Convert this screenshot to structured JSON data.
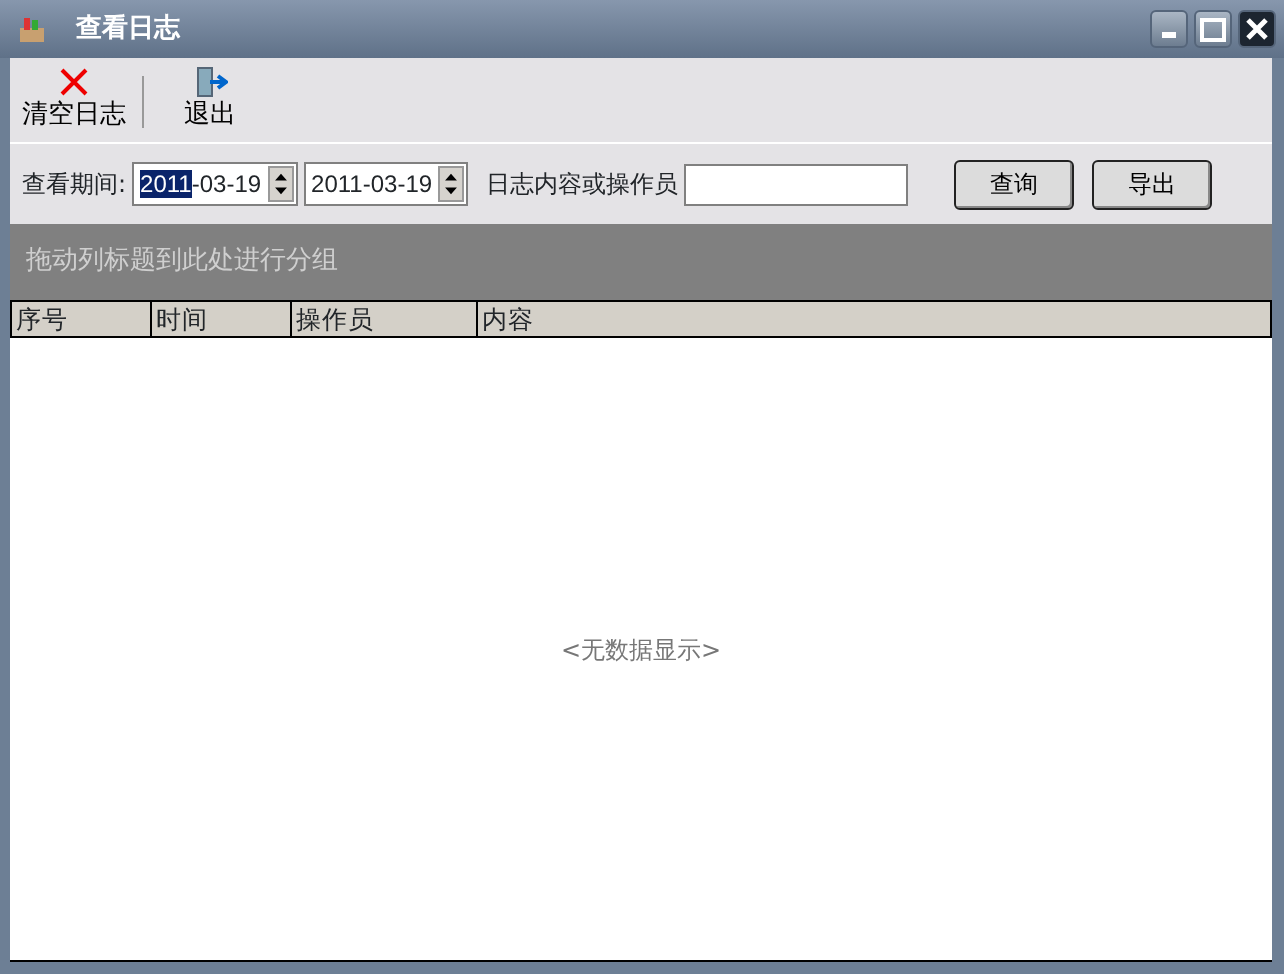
{
  "window": {
    "title": "查看日志"
  },
  "toolbar": [
    {
      "kind": "clear",
      "label": "清空日志"
    },
    {
      "kind": "exit",
      "label": "退出"
    }
  ],
  "filter": {
    "period_label": "查看期间:",
    "date_from": {
      "selected_part": "2011",
      "rest": "-03-19"
    },
    "date_to": {
      "value": "2011-03-19"
    },
    "search_label": "日志内容或操作员",
    "buttons": [
      "查询",
      "导出"
    ]
  },
  "group_panel": {
    "hint": "拖动列标题到此处进行分组"
  },
  "table": {
    "columns": [
      "序号",
      "时间",
      "操作员",
      "内容"
    ],
    "empty_text": "<无数据显示>"
  }
}
